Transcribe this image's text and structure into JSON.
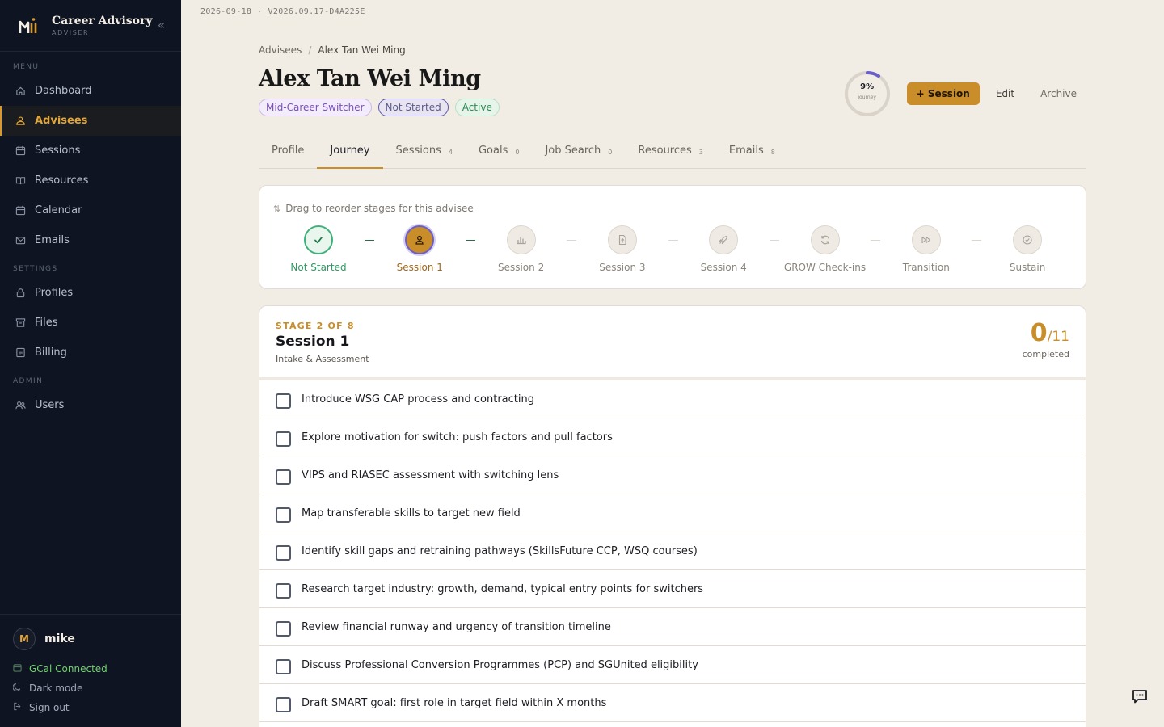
{
  "brand": {
    "name": "Career Advisory",
    "role": "ADVISER"
  },
  "sidebar": {
    "sections": [
      {
        "label": "MENU",
        "items": [
          {
            "label": "Dashboard",
            "icon": "home-icon"
          },
          {
            "label": "Advisees",
            "icon": "people-icon",
            "active": true
          },
          {
            "label": "Sessions",
            "icon": "calendar-icon"
          },
          {
            "label": "Resources",
            "icon": "book-icon"
          },
          {
            "label": "Calendar",
            "icon": "calendar-icon"
          },
          {
            "label": "Emails",
            "icon": "mail-icon"
          }
        ]
      },
      {
        "label": "SETTINGS",
        "items": [
          {
            "label": "Profiles",
            "icon": "lock-icon"
          },
          {
            "label": "Files",
            "icon": "archive-icon"
          },
          {
            "label": "Billing",
            "icon": "billing-icon"
          }
        ]
      },
      {
        "label": "ADMIN",
        "items": [
          {
            "label": "Users",
            "icon": "users-icon"
          }
        ]
      }
    ],
    "user": {
      "initial": "M",
      "name": "mike"
    },
    "gcal": "GCal Connected",
    "dark_mode": "Dark mode",
    "sign_out": "Sign out"
  },
  "topbar": {
    "date": "2026-09-18",
    "sep": "·",
    "version": "V2026.09.17-D4A225E"
  },
  "breadcrumb": {
    "parent": "Advisees",
    "sep": "/",
    "current": "Alex Tan Wei Ming"
  },
  "advisee": {
    "name": "Alex Tan Wei Ming",
    "badges": [
      "Mid-Career Switcher",
      "Not Started",
      "Active"
    ],
    "journey_percent": 9,
    "journey_percent_label": "9%",
    "journey_label": "journey"
  },
  "actions": {
    "add_session": "+ Session",
    "edit": "Edit",
    "archive": "Archive"
  },
  "tabs": [
    {
      "label": "Profile",
      "count": ""
    },
    {
      "label": "Journey",
      "count": "",
      "active": true
    },
    {
      "label": "Sessions",
      "count": "4"
    },
    {
      "label": "Goals",
      "count": "0"
    },
    {
      "label": "Job Search",
      "count": "0"
    },
    {
      "label": "Resources",
      "count": "3"
    },
    {
      "label": "Emails",
      "count": "8"
    }
  ],
  "journey": {
    "drag_hint": "Drag to reorder stages for this advisee",
    "stages": [
      {
        "name": "Not Started",
        "state": "done",
        "icon": "check-icon"
      },
      {
        "name": "Session 1",
        "state": "current",
        "icon": "person-icon"
      },
      {
        "name": "Session 2",
        "state": "todo",
        "icon": "bar-chart-icon"
      },
      {
        "name": "Session 3",
        "state": "todo",
        "icon": "file-upload-icon"
      },
      {
        "name": "Session 4",
        "state": "todo",
        "icon": "rocket-icon"
      },
      {
        "name": "GROW Check-ins",
        "state": "todo",
        "icon": "refresh-icon"
      },
      {
        "name": "Transition",
        "state": "todo",
        "icon": "fast-forward-icon"
      },
      {
        "name": "Sustain",
        "state": "todo",
        "icon": "check-circle-icon"
      }
    ]
  },
  "checklist": {
    "stage_of": "STAGE 2 OF 8",
    "title": "Session 1",
    "subtitle": "Intake & Assessment",
    "done": "0",
    "total": "/11",
    "completed_label": "completed",
    "items": [
      "Introduce WSG CAP process and contracting",
      "Explore motivation for switch: push factors and pull factors",
      "VIPS and RIASEC assessment with switching lens",
      "Map transferable skills to target new field",
      "Identify skill gaps and retraining pathways (SkillsFuture CCP, WSQ courses)",
      "Research target industry: growth, demand, typical entry points for switchers",
      "Review financial runway and urgency of transition timeline",
      "Discuss Professional Conversion Programmes (PCP) and SGUnited eligibility",
      "Draft SMART goal: first role in target field within X months"
    ]
  },
  "colors": {
    "accent": "#c98d2a",
    "sidebar_bg": "#0e1421",
    "page_bg": "#f1ece4",
    "done": "#3fb07a"
  }
}
